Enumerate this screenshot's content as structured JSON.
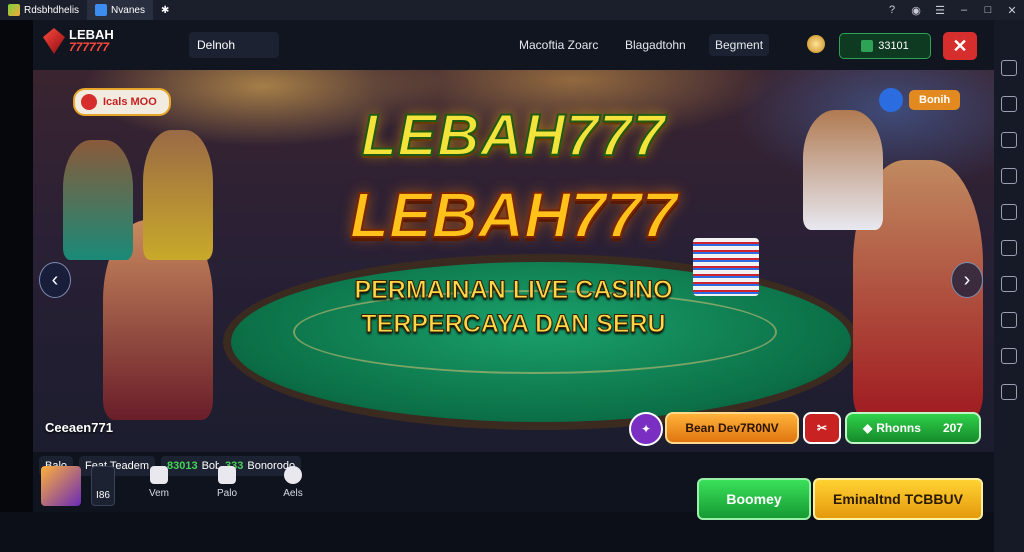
{
  "titlebar": {
    "tabs": [
      {
        "label": "Rdsbhdhelis"
      },
      {
        "label": "Nvanes"
      }
    ],
    "third_tab_icon": "✱",
    "buttons": [
      "help-icon",
      "account-icon",
      "menu-icon",
      "minimize-icon",
      "maximize-icon",
      "close-icon"
    ]
  },
  "header": {
    "brand_top": "LEBAH",
    "brand_bottom": "777777",
    "search_text": "Delnoh",
    "nav": [
      {
        "label": "Macoftia Zoarc"
      },
      {
        "label": "Blagadtohn"
      },
      {
        "label": "Begment"
      }
    ],
    "balance": "33101",
    "close_label": "✕"
  },
  "banner": {
    "promo_badge": "Icals MOO",
    "bonus_badge": "Bonih",
    "title_line1": "LEBAH777",
    "title_line2": "LEBAH777",
    "tagline_line1": "PERMAINAN LIVE CASINO",
    "tagline_line2": "TERPERCAYA DAN SERU",
    "watermark": "Ceeaen771",
    "prev_arrow": "‹",
    "next_arrow": "›",
    "pill_orange": "Bean Dev7R0NV",
    "pill_green_label": "Rhonns",
    "pill_green_value": "207"
  },
  "bottom": {
    "tabs": [
      {
        "label": "Balo"
      },
      {
        "label": "Feat Teadem"
      },
      {
        "label": "Bobbo",
        "green": "83013"
      },
      {
        "label": "Bonorodo",
        "green": "333"
      }
    ],
    "mini_label": "I86",
    "nav": [
      {
        "label": "Vem"
      },
      {
        "label": "Palo"
      },
      {
        "label": "Aels"
      }
    ],
    "cta_green": "Boomey",
    "cta_yellow": "Eminaltnd TCBBUV"
  },
  "colors": {
    "accent_green": "#2fbf45",
    "accent_yellow": "#f2b418",
    "accent_red": "#d62d2d",
    "table_green": "#0b6e46"
  }
}
